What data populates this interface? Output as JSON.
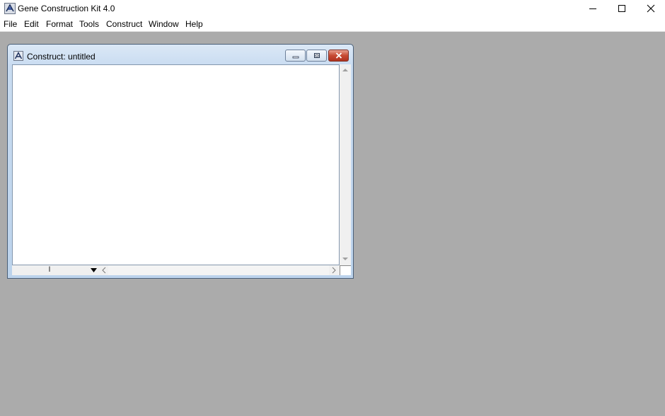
{
  "app": {
    "title": "Gene Construction Kit 4.0",
    "icon": "gck-app-icon"
  },
  "menu": {
    "items": [
      "File",
      "Edit",
      "Format",
      "Tools",
      "Construct",
      "Window",
      "Help"
    ]
  },
  "child_window": {
    "title": "Construct:  untitled",
    "icon": "gck-document-icon",
    "coordinate_readout": "l"
  },
  "colors": {
    "desktop_background": "#ababab",
    "child_frame": "#c9dcf1",
    "close_button": "#c74a33"
  }
}
